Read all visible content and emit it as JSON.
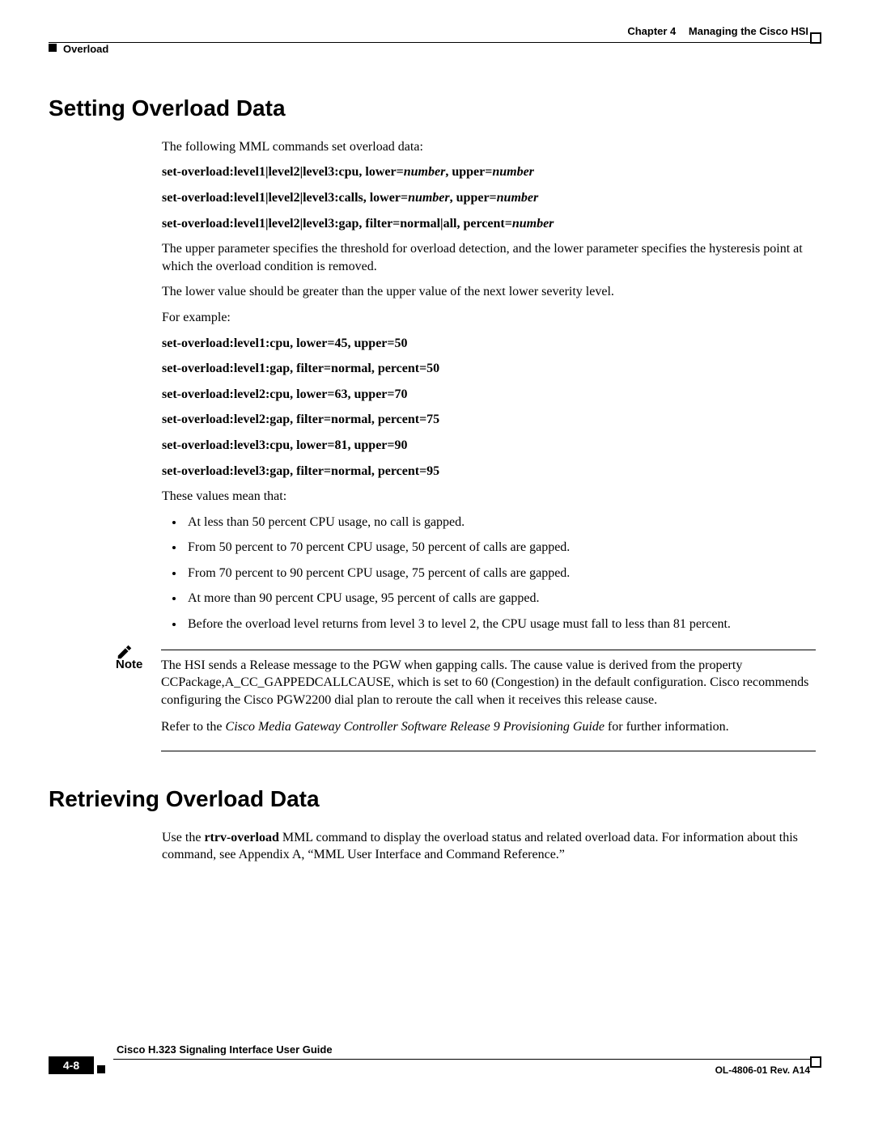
{
  "header": {
    "chapter_label": "Chapter 4",
    "chapter_title": "Managing the Cisco HSI",
    "crumb": "Overload"
  },
  "section1": {
    "title": "Setting Overload Data",
    "intro": "The following MML commands set overload data:",
    "syntax": [
      {
        "pre": "set-overload:level1|level2|level3:cpu, lower=",
        "post1": ", upper="
      },
      {
        "pre": "set-overload:level1|level2|level3:calls, lower=",
        "post1": ", upper="
      },
      {
        "pre": "set-overload:level1|level2|level3:gap, filter=normal|all, percent=",
        "post1": ""
      }
    ],
    "number_token": "number",
    "para_upper_lower": "The upper parameter specifies the threshold for overload detection, and the lower parameter specifies the hysteresis point at which the overload condition is removed.",
    "para_lower_value": "The lower value should be greater than the upper value of the next lower severity level.",
    "for_example": "For example:",
    "examples": [
      "set-overload:level1:cpu, lower=45, upper=50",
      "set-overload:level1:gap, filter=normal, percent=50",
      "set-overload:level2:cpu, lower=63, upper=70",
      "set-overload:level2:gap, filter=normal, percent=75",
      "set-overload:level3:cpu, lower=81, upper=90",
      "set-overload:level3:gap, filter=normal, percent=95"
    ],
    "these_values_mean": "These values mean that:",
    "bullets": [
      "At less than 50 percent CPU usage, no call is gapped.",
      "From 50 percent to 70 percent CPU usage, 50 percent of calls are gapped.",
      "From 70 percent to 90 percent CPU usage, 75 percent of calls are gapped.",
      "At more than 90 percent CPU usage, 95 percent of calls are gapped.",
      "Before the overload level returns from level 3 to level 2, the CPU usage must fall to less than 81 percent."
    ]
  },
  "note": {
    "label": "Note",
    "para1": "The HSI sends a Release message to the PGW when gapping calls. The cause value is derived from the property CCPackage,A_CC_GAPPEDCALLCAUSE, which is set to 60 (Congestion) in the default configuration. Cisco recommends configuring the Cisco PGW2200 dial plan to reroute the call when it receives this release cause.",
    "para2_a": "Refer to the ",
    "para2_ital": "Cisco Media Gateway Controller Software Release 9 Provisioning Guide",
    "para2_b": " for further information."
  },
  "section2": {
    "title": "Retrieving Overload Data",
    "para_a": "Use the ",
    "cmd": "rtrv-overload",
    "para_b": " MML command to display the overload status and related overload data. For information about this command, see Appendix A, “MML User Interface and Command Reference.”"
  },
  "footer": {
    "guide_title": "Cisco H.323 Signaling Interface User Guide",
    "page_number": "4-8",
    "rev": "OL-4806-01 Rev. A14"
  }
}
